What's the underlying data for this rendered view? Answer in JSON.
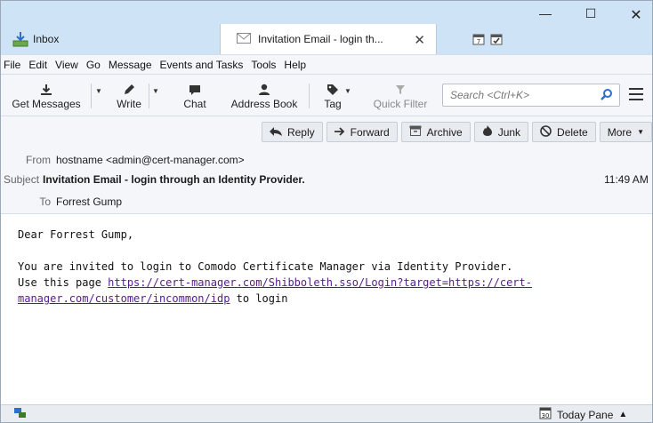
{
  "tabs": {
    "inbox_label": "Inbox",
    "active_label": "Invitation Email - login th...",
    "close_glyph": "✕"
  },
  "window_controls": {
    "minimize": "—",
    "maximize": "☐",
    "close": "✕"
  },
  "menu": [
    "File",
    "Edit",
    "View",
    "Go",
    "Message",
    "Events and Tasks",
    "Tools",
    "Help"
  ],
  "toolbar": {
    "get_messages": "Get Messages",
    "write": "Write",
    "chat": "Chat",
    "address_book": "Address Book",
    "tag": "Tag",
    "quick_filter": "Quick Filter",
    "search_placeholder": "Search <Ctrl+K>"
  },
  "header_actions": {
    "reply": "Reply",
    "forward": "Forward",
    "archive": "Archive",
    "junk": "Junk",
    "delete": "Delete",
    "more": "More"
  },
  "message": {
    "from_label": "From",
    "from_value": "hostname <admin@cert-manager.com>",
    "subject_label": "Subject",
    "subject_value": "Invitation Email - login through an Identity Provider.",
    "to_label": "To",
    "to_value": "Forrest Gump",
    "time": "11:49 AM",
    "greeting": "Dear Forrest Gump,",
    "line1": "You are invited to login to Comodo Certificate Manager via Identity Provider.",
    "line2_prefix": "Use this page ",
    "link_part1": "https://cert-manager.com/Shibboleth.sso/Login?target=https://cert-",
    "link_part2": "manager.com/customer/incommon/idp",
    "line3_suffix": " to login"
  },
  "statusbar": {
    "today_pane": "Today Pane"
  },
  "colors": {
    "titlebar": "#cfe3f7",
    "toolbar_bg": "#f4f6f9",
    "link": "#551a8b",
    "accent_blue": "#2a6fc9"
  }
}
